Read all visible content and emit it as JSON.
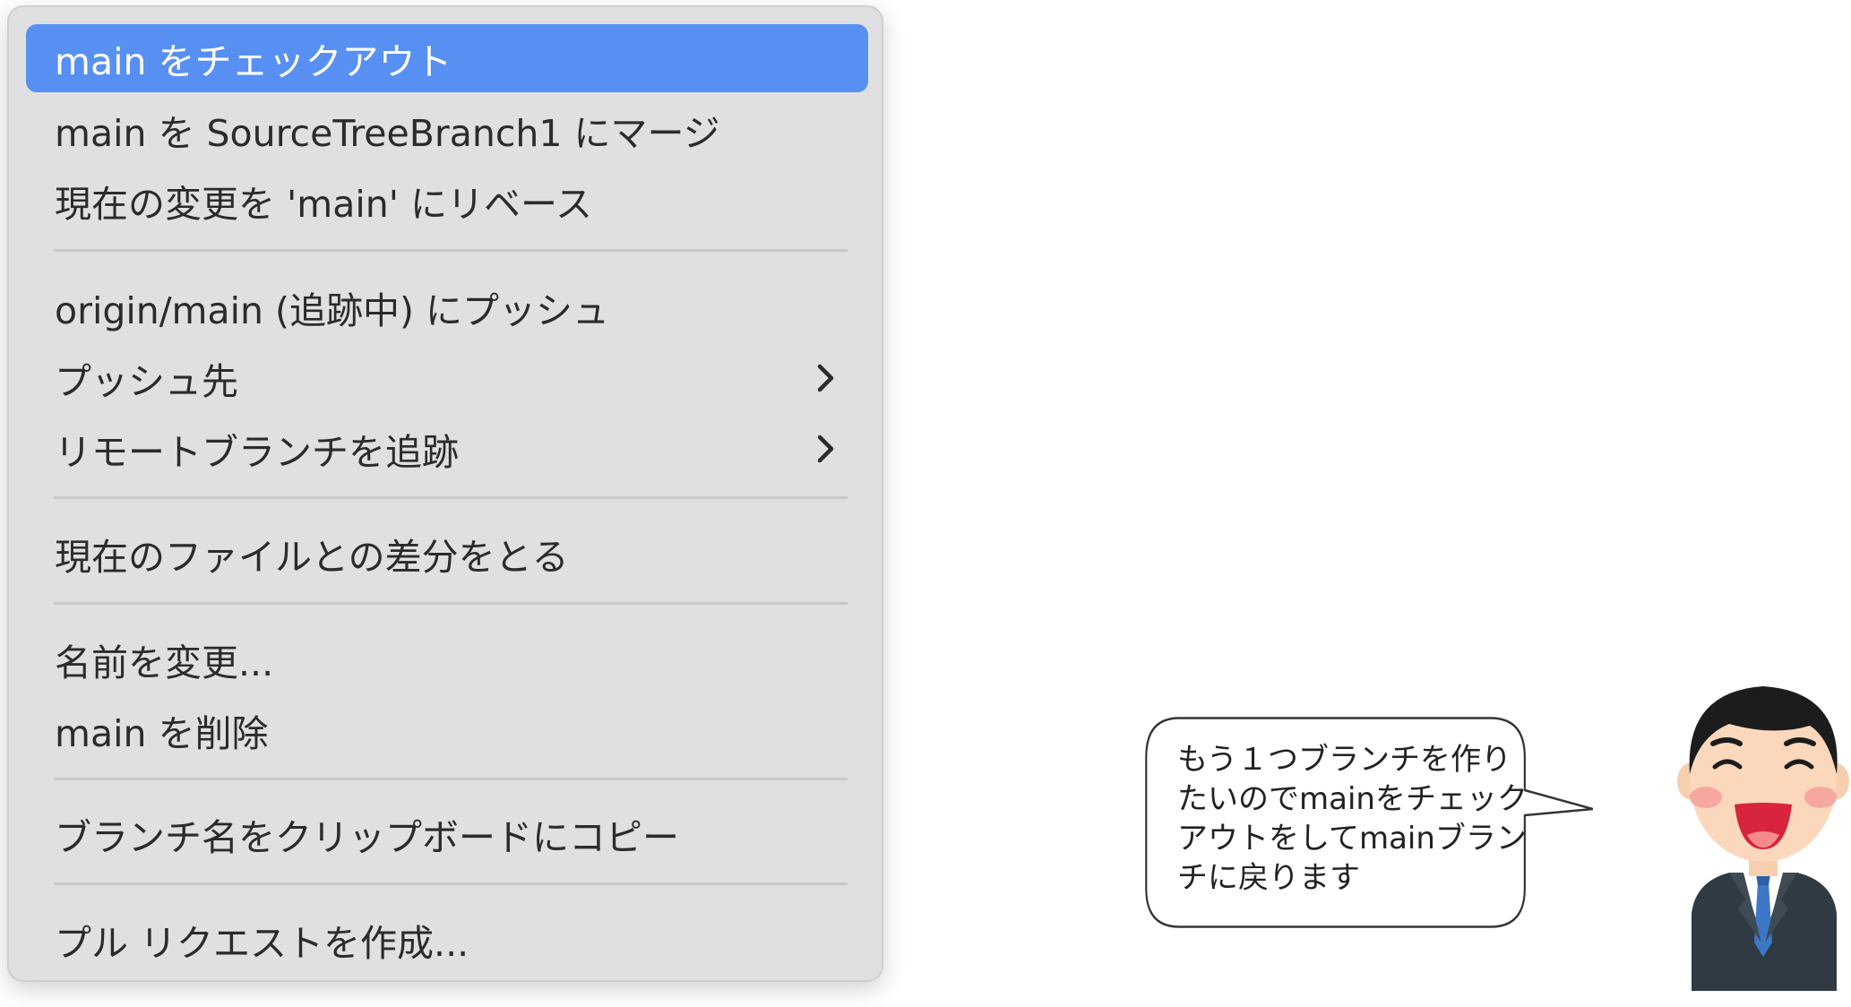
{
  "menu": {
    "items": [
      {
        "label": "main をチェックアウト"
      },
      {
        "label": "main を SourceTreeBranch1 にマージ"
      },
      {
        "label": "現在の変更を 'main' にリベース"
      },
      {
        "label": "origin/main (追跡中) にプッシュ"
      },
      {
        "label": "プッシュ先"
      },
      {
        "label": "リモートブランチを追跡"
      },
      {
        "label": "現在のファイルとの差分をとる"
      },
      {
        "label": "名前を変更..."
      },
      {
        "label": "main を削除"
      },
      {
        "label": "ブランチ名をクリップボードにコピー"
      },
      {
        "label": "プル リクエストを作成..."
      }
    ],
    "selected_index": 0,
    "submenu_indices": [
      4,
      5
    ]
  },
  "speech_bubble": {
    "lines": [
      "もう１つブランチを作り",
      "たいのでmainをチェック",
      "アウトをしてmainブラン",
      "チに戻ります"
    ]
  },
  "colors": {
    "menu_background": "#e0e0e2",
    "selection": "#5790f2",
    "separator": "#c9c9cc"
  }
}
